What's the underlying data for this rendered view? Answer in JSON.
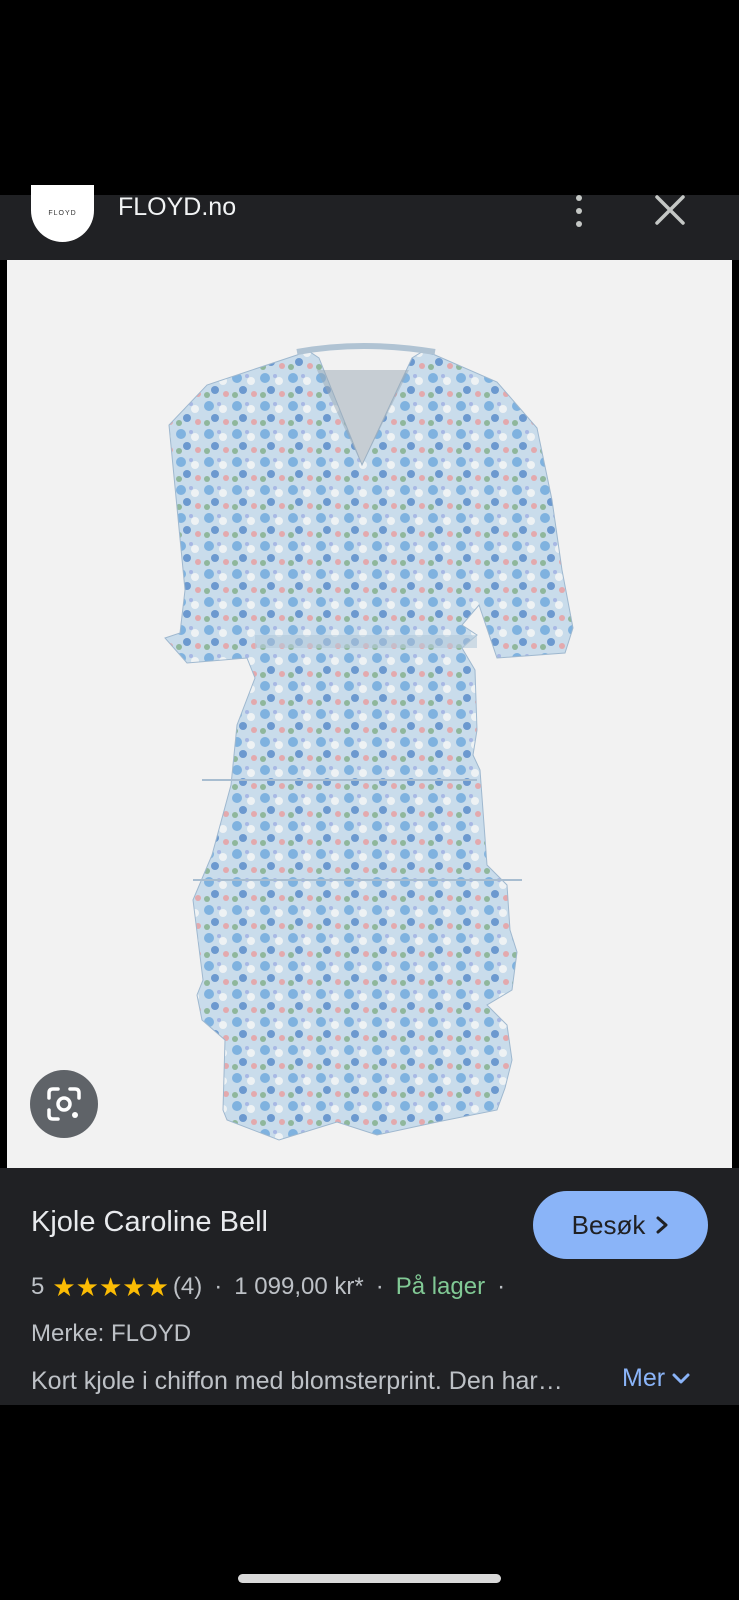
{
  "header": {
    "logo_text": "FLOYD",
    "site_name": "FLOYD.no",
    "menu_icon": "more-vert-icon",
    "close_icon": "close-icon"
  },
  "image": {
    "alt": "Kjole Caroline Bell",
    "lens_icon": "google-lens-icon"
  },
  "product": {
    "title": "Kjole Caroline Bell",
    "visit_label": "Besøk",
    "rating_value": "5",
    "stars_count": 5,
    "review_count": "(4)",
    "price": "1 099,00 kr*",
    "availability": "På lager",
    "separator": "·",
    "brand": "Merke: FLOYD",
    "description": "Kort kjole i chiffon med blomsterprint. Den har…",
    "more_label": "Mer"
  },
  "colors": {
    "panel": "#202124",
    "accent": "#8ab4f8",
    "in_stock": "#81c995",
    "star": "#fbbc04"
  }
}
